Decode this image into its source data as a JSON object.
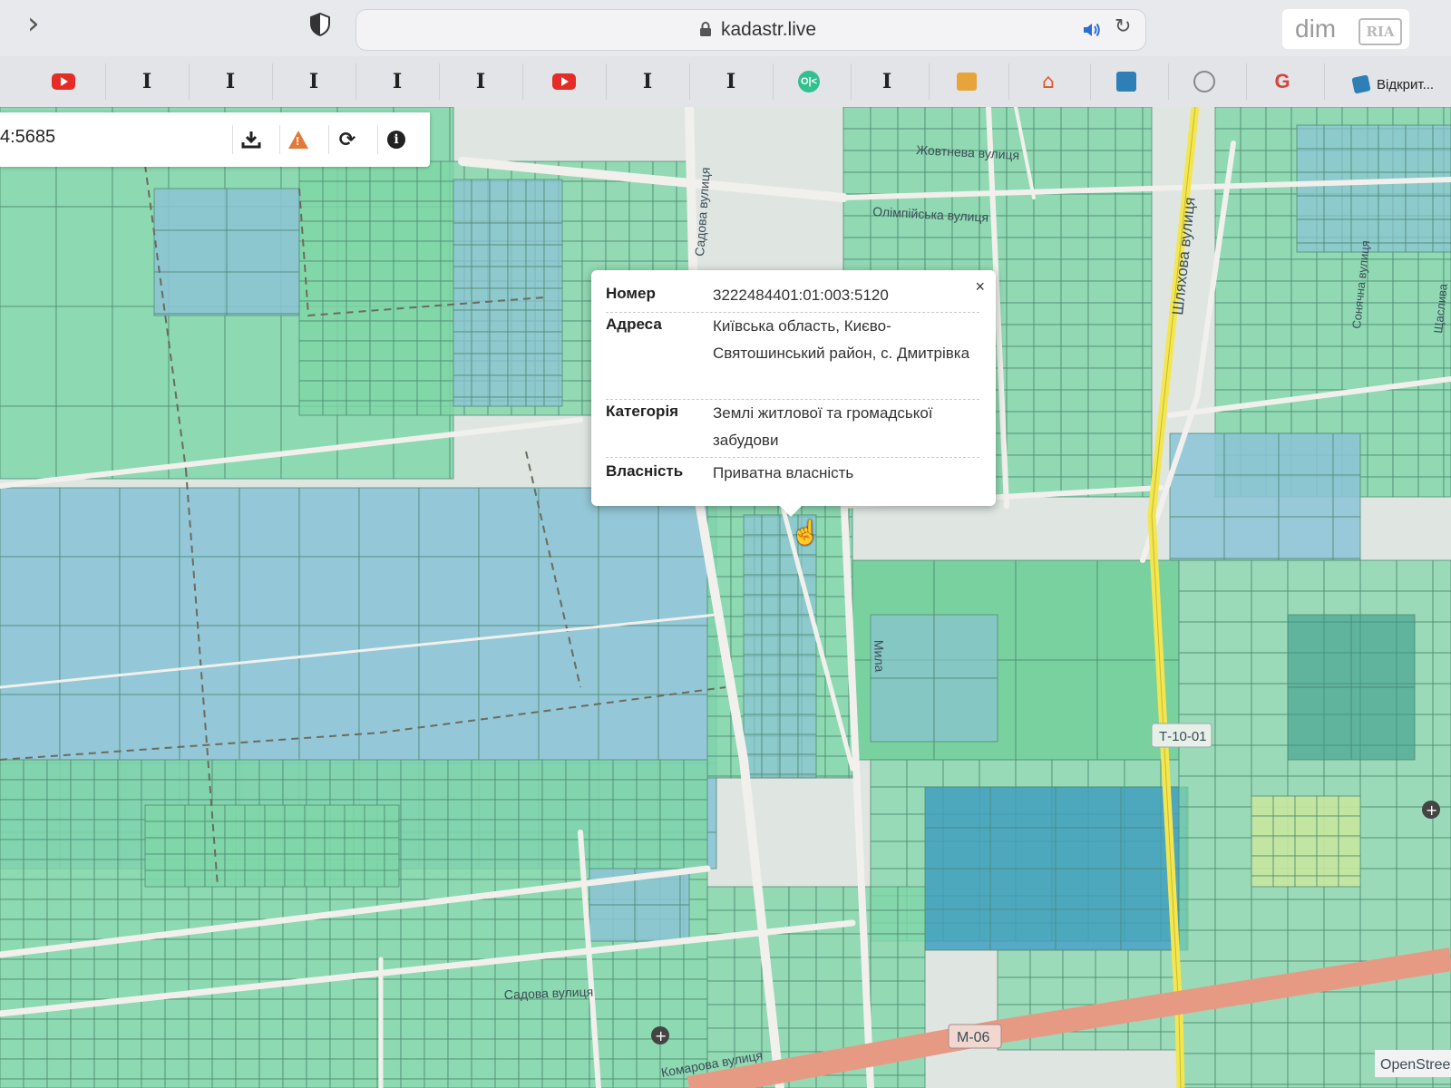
{
  "browser": {
    "url": "kadastr.live",
    "bookmarks": [
      {
        "icon": "youtube-icon"
      },
      {
        "icon": "pin-icon"
      },
      {
        "icon": "pin-icon"
      },
      {
        "icon": "pin-icon"
      },
      {
        "icon": "pin-icon"
      },
      {
        "icon": "pin-icon"
      },
      {
        "icon": "youtube-icon"
      },
      {
        "icon": "pin-icon"
      },
      {
        "icon": "pin-icon"
      },
      {
        "icon": "ok-icon"
      },
      {
        "icon": "pin-icon"
      },
      {
        "icon": "box-icon"
      },
      {
        "icon": "home-icon"
      },
      {
        "icon": "square-icon"
      },
      {
        "icon": "circle-icon"
      },
      {
        "icon": "google-icon"
      }
    ],
    "bookmark_last_label": "Відкрит...",
    "ok_text": "O|<"
  },
  "watermark": {
    "brand": "dim",
    "ria": "RIA"
  },
  "toolbar": {
    "search_value": "4:5685",
    "icons": [
      "download-icon",
      "warning-icon",
      "refresh-icon",
      "info-icon"
    ]
  },
  "popup": {
    "close": "×",
    "rows": [
      {
        "label": "Номер",
        "value": "3222484401:01:003:5120"
      },
      {
        "label": "Адреса",
        "value": "Київська область, Києво-Святошинський район, с. Дмитрівка"
      },
      {
        "label": "Категорія",
        "value": "Землі житлової та громадської забудови"
      },
      {
        "label": "Власність",
        "value": "Приватна власність"
      }
    ]
  },
  "map": {
    "street_labels": {
      "zhovtneva": "Жовтнева вулиця",
      "olimpiiska": "Олімпійська вулиця",
      "sadova_vert": "Садова вулиця",
      "shliakhova": "Шляхова вулиця",
      "sonyachna": "Сонячна вулиця",
      "shchaslyva": "Щаслива",
      "myla": "Мила",
      "sadova_bottom": "Садова вулиця",
      "komarova": "Комарова вулиця",
      "road_t1001": "Т-10-01",
      "road_m06": "М-06",
      "attribution": "OpenStree"
    },
    "colors": {
      "parcel_green": "#7fd6a8",
      "parcel_blue": "#8cc3d6",
      "road": "#efeeea",
      "highway": "#e89a82",
      "main_road": "#f2e34a"
    }
  }
}
